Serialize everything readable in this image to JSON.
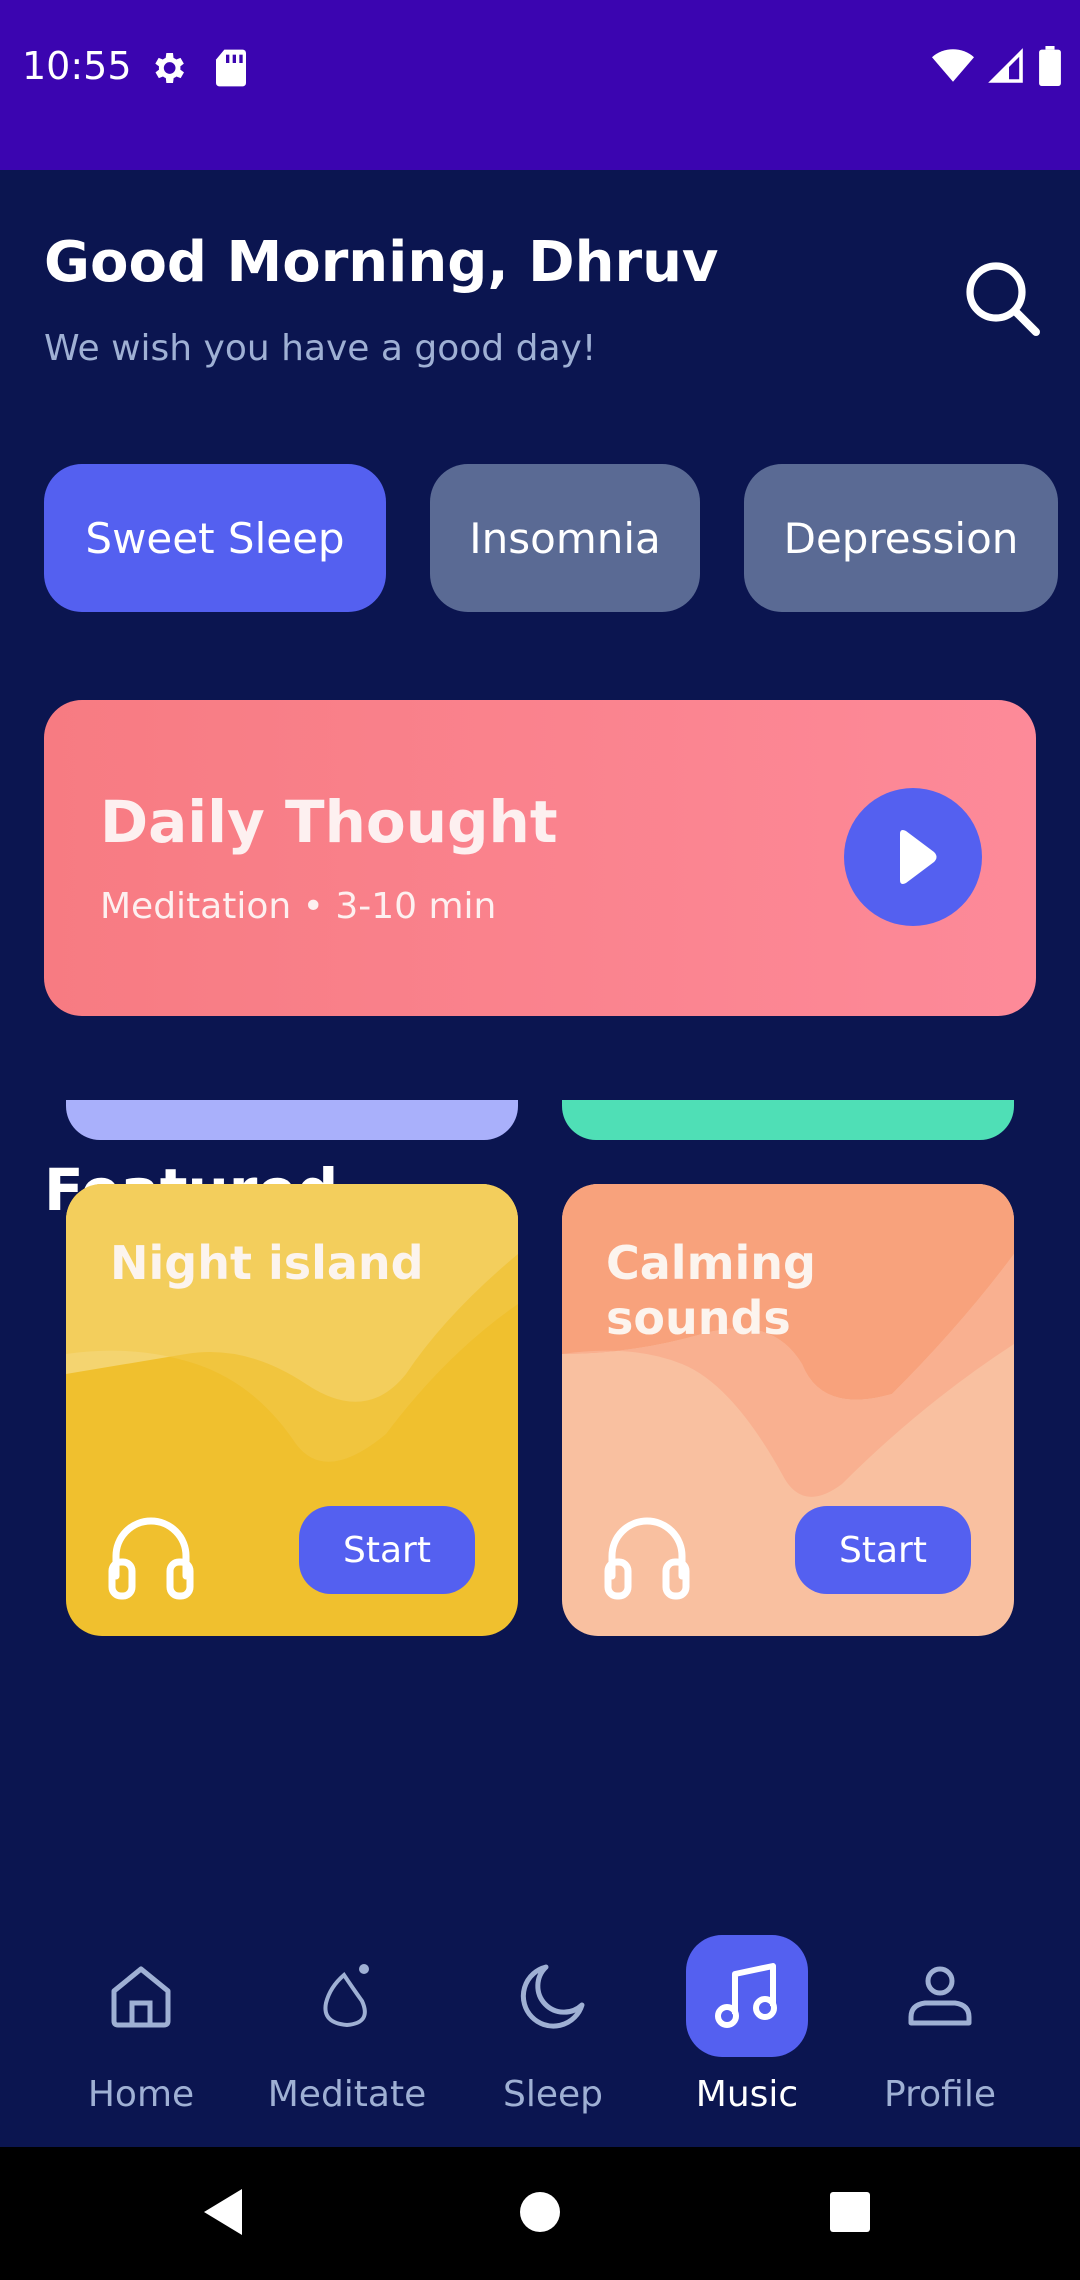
{
  "colors": {
    "status_bar": "#3b05b0",
    "background": "#0b1550",
    "accent": "#5460f0",
    "chip_inactive": "#5a6a94",
    "daily_card_start": "#f77b82",
    "daily_card_end": "#fd8a99",
    "card_yellow": "#f0c02e",
    "card_peach": "#f9c0a0",
    "peek_lavender": "#a9b0fb",
    "peek_mint": "#4fdfb6",
    "muted_text": "#9fb0d4"
  },
  "status_bar": {
    "time": "10:55",
    "left_icons": [
      "settings-icon",
      "sd-card-icon"
    ],
    "right_icons": [
      "wifi-icon",
      "signal-icon",
      "battery-icon"
    ]
  },
  "header": {
    "greeting": "Good Morning, Dhruv",
    "subtitle": "We wish you have a good day!",
    "search_icon": "search-icon"
  },
  "chips": [
    {
      "label": "Sweet Sleep",
      "active": true
    },
    {
      "label": "Insomnia",
      "active": false
    },
    {
      "label": "Depression",
      "active": false
    }
  ],
  "daily_thought": {
    "title": "Daily Thought",
    "meta": "Meditation • 3-10 min",
    "play_icon": "play-icon"
  },
  "featured": {
    "title": "Featured",
    "cards": [
      {
        "title": "Night island",
        "button": "Start",
        "icon": "headphones-icon"
      },
      {
        "title": "Calming sounds",
        "button": "Start",
        "icon": "headphones-icon"
      }
    ]
  },
  "bottom_nav": {
    "items": [
      {
        "label": "Home",
        "icon": "home-icon",
        "active": false
      },
      {
        "label": "Meditate",
        "icon": "meditate-icon",
        "active": false
      },
      {
        "label": "Sleep",
        "icon": "moon-icon",
        "active": false
      },
      {
        "label": "Music",
        "icon": "music-note-icon",
        "active": true
      },
      {
        "label": "Profile",
        "icon": "profile-icon",
        "active": false
      }
    ]
  },
  "system_nav": [
    "back-icon",
    "home-circle-icon",
    "recents-icon"
  ]
}
